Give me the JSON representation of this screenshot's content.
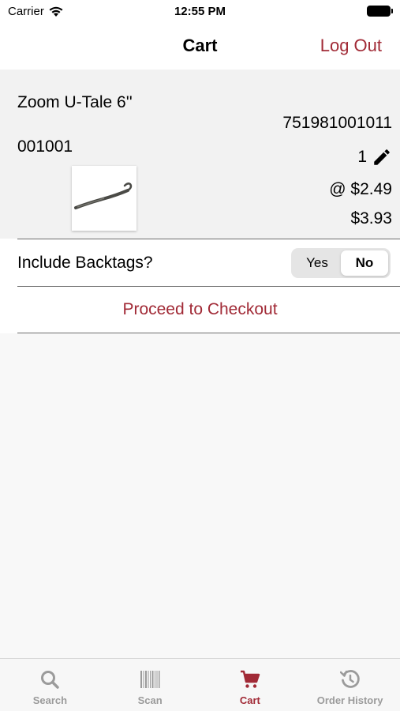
{
  "status_bar": {
    "carrier": "Carrier",
    "time": "12:55 PM"
  },
  "nav": {
    "title": "Cart",
    "logout_label": "Log Out"
  },
  "cart_items": [
    {
      "name": "Zoom U-Tale 6''",
      "upc": "751981001011",
      "sku": "001001",
      "quantity": "1",
      "unit_price": "@ $2.49",
      "line_total": "$3.93"
    }
  ],
  "backtags": {
    "label": "Include Backtags?",
    "options": [
      "Yes",
      "No"
    ],
    "selected": "No"
  },
  "checkout": {
    "label": "Proceed to Checkout"
  },
  "tabs": [
    {
      "label": "Search",
      "icon": "search-icon",
      "active": false
    },
    {
      "label": "Scan",
      "icon": "barcode-icon",
      "active": false
    },
    {
      "label": "Cart",
      "icon": "cart-icon",
      "active": true
    },
    {
      "label": "Order History",
      "icon": "history-icon",
      "active": false
    }
  ],
  "colors": {
    "accent": "#a12a36",
    "inactive": "#9b9b9b",
    "background": "#f8f8f8"
  }
}
